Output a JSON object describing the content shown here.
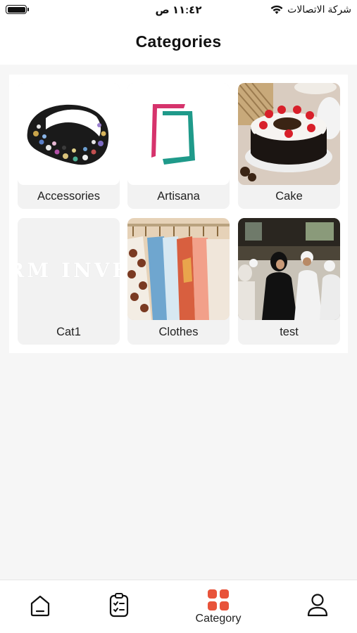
{
  "status_bar": {
    "time": "١١:٤٢ ص",
    "carrier": "شركة الاتصالات"
  },
  "header": {
    "title": "Categories"
  },
  "categories": [
    {
      "label": "Accessories",
      "image": "headband-photo"
    },
    {
      "label": "Artisana",
      "image": "artisana-logo"
    },
    {
      "label": "Cake",
      "image": "cake-photo"
    },
    {
      "label": "Cat1",
      "image": "watermark-placeholder",
      "watermark": "RM INVE"
    },
    {
      "label": "Clothes",
      "image": "clothes-rack-photo"
    },
    {
      "label": "test",
      "image": "event-photo"
    }
  ],
  "bottom_nav": {
    "items": [
      {
        "icon": "home-icon"
      },
      {
        "icon": "clipboard-icon"
      },
      {
        "icon": "category-grid-icon",
        "label": "Category",
        "active": true
      },
      {
        "icon": "profile-icon"
      }
    ]
  },
  "colors": {
    "accent": "#e8533a",
    "background": "#f6f6f6",
    "card_label_bg": "#f2f2f2"
  }
}
